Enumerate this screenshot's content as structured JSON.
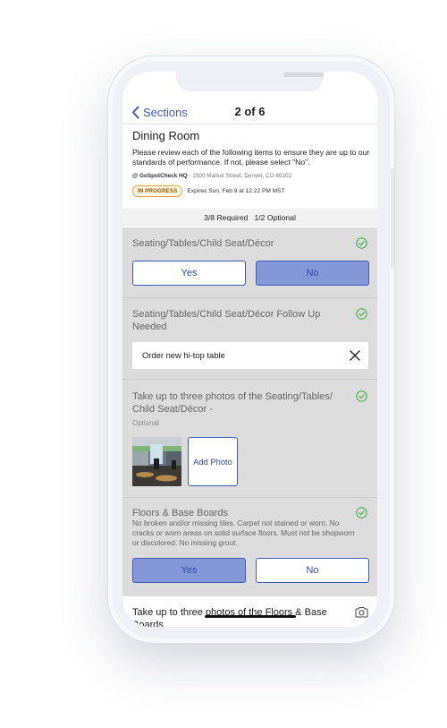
{
  "nav": {
    "back_label": "Sections",
    "title": "2 of 6"
  },
  "header": {
    "section_title": "Dining Room",
    "description": "Please review each of the following items to ensure they are up to our standards of performance. If not, please select \"No\".",
    "location_name": "@ GoSpotCheck HQ",
    "location_address": " - 1500 Market Street, Denver, CO 80202",
    "status_badge": "IN PROGRESS",
    "expires": "Expires Sun, Feb 9 at 12:22 PM MST"
  },
  "counts": {
    "required": "3/8 Required",
    "optional": "1/2 Optional"
  },
  "questions": [
    {
      "text": "Seating/Tables/Child Seat/Décor",
      "yes_label": "Yes",
      "no_label": "No",
      "selected": "No"
    },
    {
      "text": "Seating/Tables/Child Seat/Décor Follow Up Needed",
      "answer": "Order new hi-top table"
    },
    {
      "text": "Take up to three photos of the Seating/Tables/ Child Seat/Décor -",
      "optional_label": "Optional",
      "add_photo_label": "Add Photo"
    },
    {
      "text": "Floors & Base Boards",
      "description": "No broken and/or missing tiles.  Carpet not stained or worn.  No cracks or worn areas on solid surface floors.  Must not be shopworn or discolored.  No missing grout.",
      "yes_label": "Yes",
      "no_label": "No",
      "selected": "Yes"
    },
    {
      "text": "Take up to three photos of the Floors & Base Boards"
    }
  ],
  "colors": {
    "accent": "#3f5bb8",
    "selected_fill": "#8497d6",
    "check": "#4caf50",
    "badge_border": "#e8a443"
  },
  "icons": {
    "back": "chevron-left-icon",
    "check": "check-circle-icon",
    "clear": "close-icon",
    "camera": "camera-icon"
  }
}
